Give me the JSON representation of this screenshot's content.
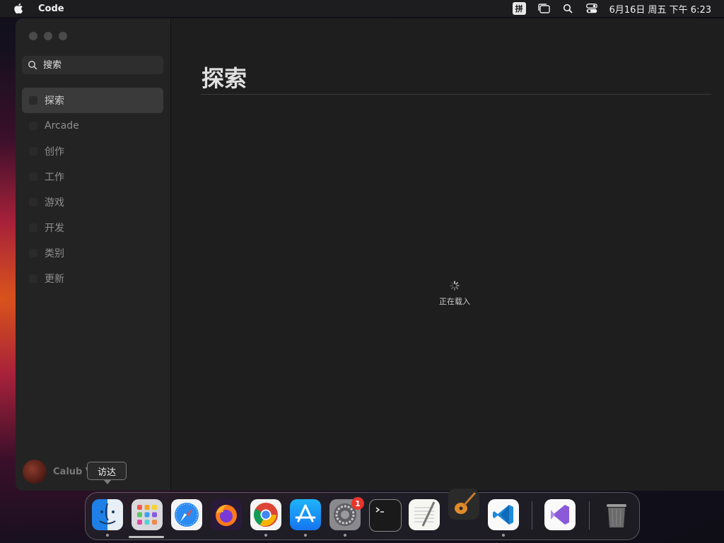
{
  "menubar": {
    "app_name": "Code",
    "ime": "拼",
    "datetime": "6月16日 周五  下午 6:23"
  },
  "sidebar": {
    "search_placeholder": "搜索",
    "items": [
      {
        "label": "探索",
        "active": true
      },
      {
        "label": "Arcade"
      },
      {
        "label": "创作"
      },
      {
        "label": "工作"
      },
      {
        "label": "游戏"
      },
      {
        "label": "开发"
      },
      {
        "label": "类别"
      },
      {
        "label": "更新"
      }
    ],
    "user_name": "Calub V"
  },
  "main": {
    "title": "探索",
    "loading_text": "正在载入"
  },
  "tooltip": "访达",
  "dock": {
    "items": [
      "finder",
      "launchpad",
      "safari",
      "firefox",
      "chrome",
      "app-store",
      "system-settings",
      "terminal",
      "textedit",
      "garageband",
      "vscode",
      "visual-studio",
      "trash"
    ],
    "system_settings_badge": "1"
  }
}
